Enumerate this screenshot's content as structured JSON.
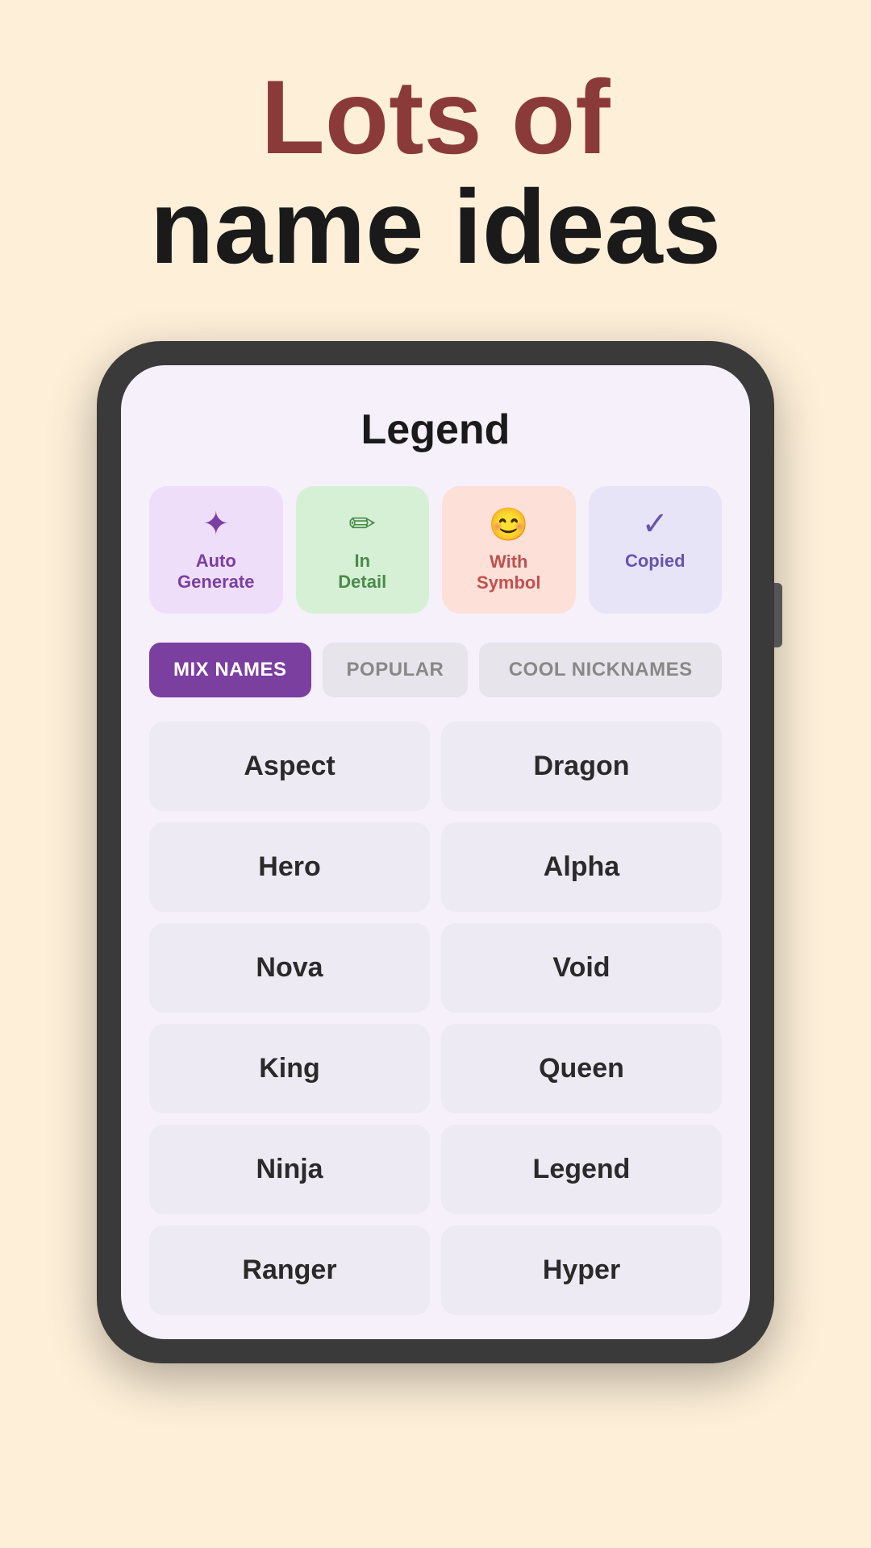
{
  "hero": {
    "line1": "Lots of",
    "line2": "name ideas"
  },
  "screen": {
    "title": "Legend"
  },
  "badges": [
    {
      "id": "auto-generate",
      "icon": "✦",
      "label": "Auto\nGenerate",
      "colorClass": "badge-auto"
    },
    {
      "id": "in-detail",
      "icon": "✏",
      "label": "In\nDetail",
      "colorClass": "badge-in-detail"
    },
    {
      "id": "with-symbol",
      "icon": "😊",
      "label": "With\nSymbol",
      "colorClass": "badge-with-symbol"
    },
    {
      "id": "copied",
      "icon": "✓",
      "label": "Copied",
      "colorClass": "badge-copied"
    }
  ],
  "filters": [
    {
      "id": "mix-names",
      "label": "MIX NAMES",
      "active": true
    },
    {
      "id": "popular",
      "label": "POPULAR",
      "active": false
    },
    {
      "id": "cool-nicknames",
      "label": "COOL NICKNAMES",
      "active": false,
      "wide": true
    }
  ],
  "names": [
    {
      "left": "Aspect",
      "right": "Dragon"
    },
    {
      "left": "Hero",
      "right": "Alpha"
    },
    {
      "left": "Nova",
      "right": "Void"
    },
    {
      "left": "King",
      "right": "Queen"
    },
    {
      "left": "Ninja",
      "right": "Legend"
    },
    {
      "left": "Ranger",
      "right": "Hyper"
    }
  ]
}
